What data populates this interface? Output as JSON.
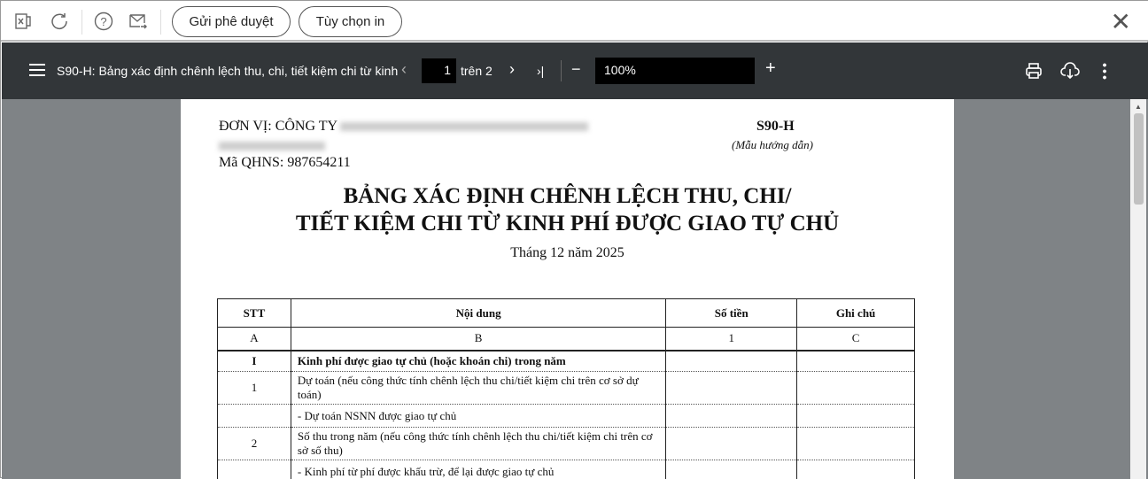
{
  "toolbar": {
    "icons": [
      "excel-icon",
      "refresh-icon",
      "help-icon",
      "send-mail-icon"
    ],
    "send_approval": "Gửi phê duyệt",
    "print_options": "Tùy chọn in"
  },
  "viewer": {
    "title": "S90-H: Bảng xác định chênh lệch thu, chi, tiết kiệm chi từ kinh ...",
    "page": "1",
    "page_total": "trên 2",
    "zoom": "100%"
  },
  "document": {
    "unit_label": "ĐƠN VỊ: CÔNG TY",
    "qhns": "Mã QHNS: 987654211",
    "form_code": "S90-H",
    "form_note": "(Mẫu hướng dẫn)",
    "title_line1": "BẢNG XÁC ĐỊNH CHÊNH LỆCH THU, CHI/",
    "title_line2": "TIẾT KIỆM CHI TỪ KINH PHÍ ĐƯỢC GIAO TỰ CHỦ",
    "period": "Tháng 12 năm 2025",
    "table": {
      "headers": [
        "STT",
        "Nội dung",
        "Số tiền",
        "Ghi chú"
      ],
      "codes": [
        "A",
        "B",
        "1",
        "C"
      ],
      "rows": [
        {
          "stt": "I",
          "content": "Kinh phí được giao tự chủ (hoặc khoán chi) trong năm",
          "bold": true
        },
        {
          "stt": "1",
          "content": "Dự toán (nếu công thức tính chênh lệch thu chi/tiết kiệm chi trên cơ sở dự toán)"
        },
        {
          "stt": "",
          "content": "- Dự toán NSNN được giao tự chủ"
        },
        {
          "stt": "2",
          "content": "Số thu trong năm (nếu công thức tính chênh lệch thu chi/tiết kiệm chi trên cơ sở số thu)"
        },
        {
          "stt": "",
          "content": "- Kinh phí từ phí được khấu trừ, để lại được giao tự chủ"
        }
      ]
    }
  }
}
